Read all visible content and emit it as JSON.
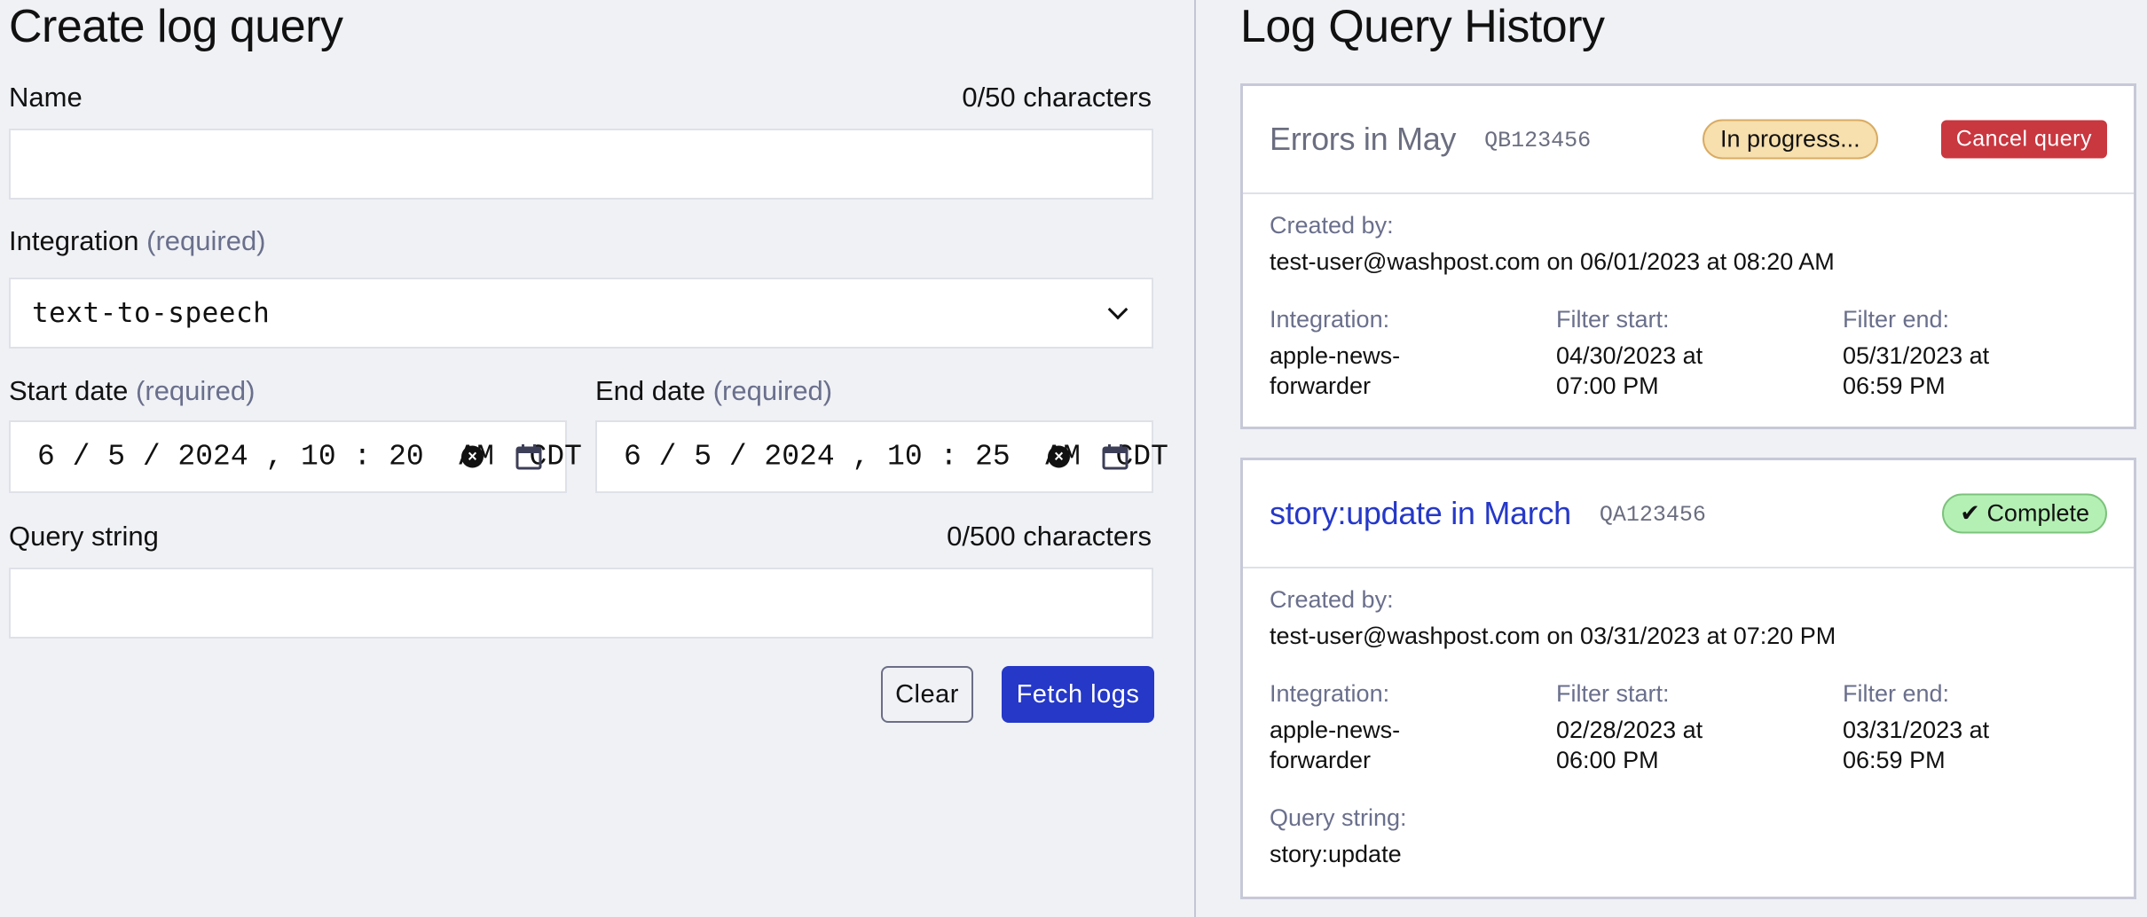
{
  "form": {
    "title": "Create log query",
    "name": {
      "label": "Name",
      "counter": "0/50 characters",
      "value": "",
      "placeholder": ""
    },
    "integration": {
      "label": "Integration",
      "required_label": "(required)",
      "selected": "text-to-speech",
      "chevron_icon": "chevron-down-icon"
    },
    "start_date": {
      "label": "Start date",
      "required_label": "(required)",
      "value": "6 / 5 / 2024 , 10 : 20  AM  CDT",
      "clear_icon": "clear-icon",
      "calendar_icon": "calendar-icon"
    },
    "end_date": {
      "label": "End date",
      "required_label": "(required)",
      "value": "6 / 5 / 2024 , 10 : 25  AM  CDT",
      "clear_icon": "clear-icon",
      "calendar_icon": "calendar-icon"
    },
    "query_string": {
      "label": "Query string",
      "counter": "0/500 characters",
      "value": "",
      "placeholder": ""
    },
    "buttons": {
      "clear": "Clear",
      "fetch": "Fetch logs"
    }
  },
  "history": {
    "title": "Log Query History",
    "cards": [
      {
        "name": "Errors in May",
        "id": "QB123456",
        "status": "In progress...",
        "action": "Cancel query",
        "created_by_label": "Created by:",
        "created_by": "test-user@washpost.com on 06/01/2023 at 08:20 AM",
        "integration_label": "Integration:",
        "integration": "apple-news-forwarder",
        "integration_line1": "apple-news-",
        "integration_line2": "forwarder",
        "filter_start_label": "Filter start:",
        "filter_start_line1": "04/30/2023 at",
        "filter_start_line2": "07:00 PM",
        "filter_end_label": "Filter end:",
        "filter_end_line1": "05/31/2023 at",
        "filter_end_line2": "06:59 PM"
      },
      {
        "name": "story:update in March",
        "id": "QA123456",
        "status_icon": "check-icon",
        "status_check": "✔",
        "status": "Complete",
        "created_by_label": "Created by:",
        "created_by": "test-user@washpost.com on 03/31/2023 at 07:20 PM",
        "integration_label": "Integration:",
        "integration_line1": "apple-news-",
        "integration_line2": "forwarder",
        "filter_start_label": "Filter start:",
        "filter_start_line1": "02/28/2023 at",
        "filter_start_line2": "06:00 PM",
        "filter_end_label": "Filter end:",
        "filter_end_line1": "03/31/2023 at",
        "filter_end_line2": "06:59 PM",
        "query_string_label": "Query string:",
        "query_string": "story:update"
      }
    ]
  },
  "colors": {
    "primary": "#2538c8",
    "danger": "#c9373f",
    "progress_bg": "#f7dfae",
    "complete_bg": "#b4f0b4",
    "muted_text": "#6a6f8c",
    "link_title": "#2538c8",
    "inactive_title": "#6b6e80"
  }
}
